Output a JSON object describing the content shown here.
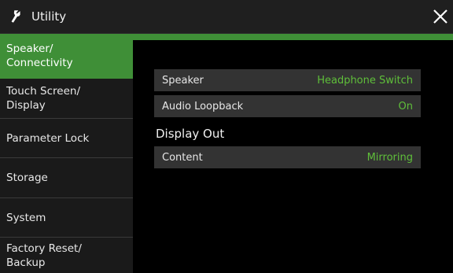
{
  "window": {
    "title": "Utility",
    "icon": "wrench-icon",
    "close_icon": "close-icon"
  },
  "sidebar": {
    "items": [
      {
        "label": "Speaker/\nConnectivity",
        "active": true
      },
      {
        "label": "Touch Screen/\nDisplay",
        "active": false
      },
      {
        "label": "Parameter Lock",
        "active": false
      },
      {
        "label": "Storage",
        "active": false
      },
      {
        "label": "System",
        "active": false
      },
      {
        "label": "Factory Reset/\nBackup",
        "active": false
      }
    ]
  },
  "settings": {
    "speaker": {
      "label": "Speaker",
      "value": "Headphone Switch"
    },
    "audio_loopback": {
      "label": "Audio Loopback",
      "value": "On"
    }
  },
  "display_out": {
    "heading": "Display Out",
    "content": {
      "label": "Content",
      "value": "Mirroring"
    }
  },
  "colors": {
    "accent": "#3f8f37",
    "value_text": "#5fbf3a",
    "row_bg": "#333333"
  }
}
